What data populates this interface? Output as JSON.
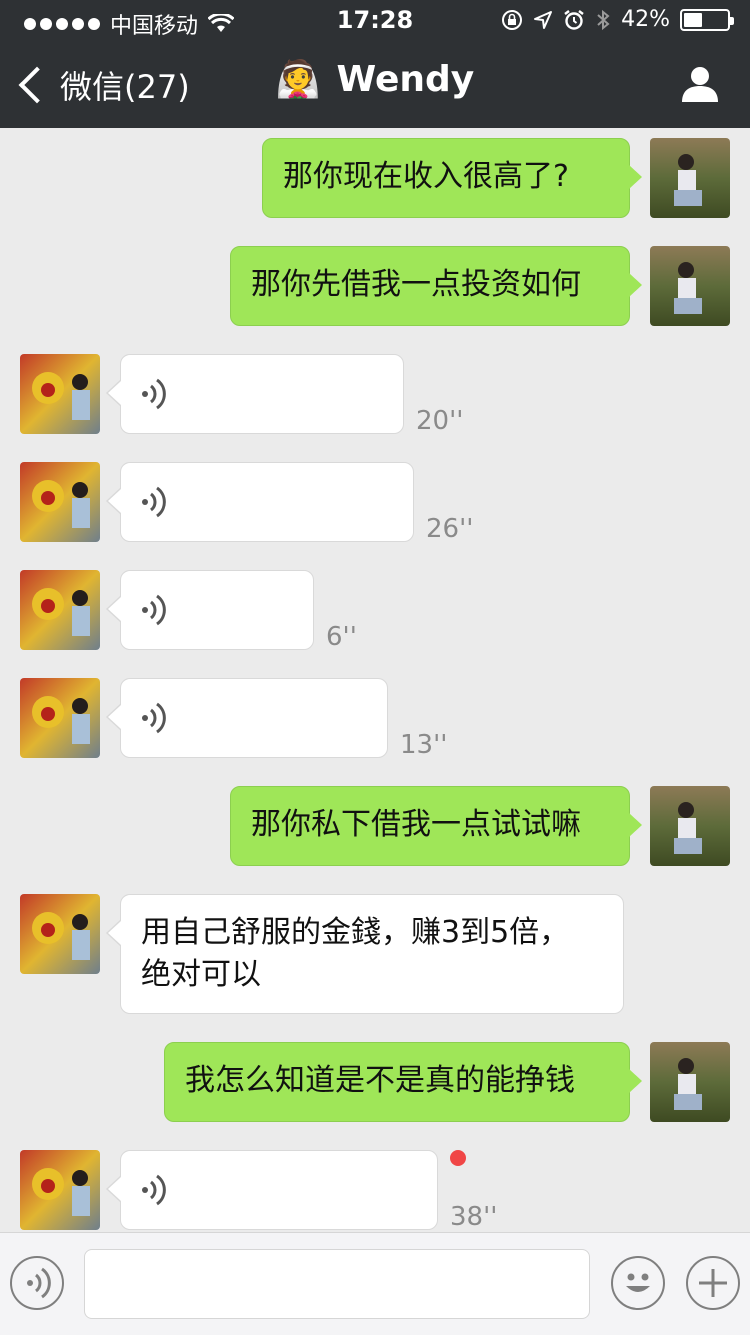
{
  "status_bar": {
    "carrier": "中国移动",
    "time": "17:28",
    "battery": "42%",
    "battery_level": 0.42
  },
  "nav": {
    "back_label": "微信(27)",
    "contact_emoji": "👰",
    "contact_name": "Wendy"
  },
  "messages": [
    {
      "side": "out",
      "text": "那你现在收入很高了?"
    },
    {
      "side": "out",
      "text": "那你先借我一点投资如何"
    },
    {
      "side": "in",
      "type": "voice",
      "duration": "20''"
    },
    {
      "side": "in",
      "type": "voice",
      "duration": "26''"
    },
    {
      "side": "in",
      "type": "voice",
      "duration": "6''"
    },
    {
      "side": "in",
      "type": "voice",
      "duration": "13''"
    },
    {
      "side": "out",
      "text": "那你私下借我一点试试嘛"
    },
    {
      "side": "in",
      "text_line1": "用自己舒服的金錢，赚3到5倍，",
      "text_line2": "绝对可以"
    },
    {
      "side": "out",
      "text": "我怎么知道是不是真的能挣钱"
    },
    {
      "side": "in",
      "type": "voice",
      "duration": "38''",
      "unread": true
    }
  ],
  "colors": {
    "header_bg": "#2e3134",
    "chat_bg": "#ebebeb",
    "outgoing_bubble": "#9fe658",
    "incoming_bubble": "#ffffff",
    "unread_dot": "#f04646"
  }
}
